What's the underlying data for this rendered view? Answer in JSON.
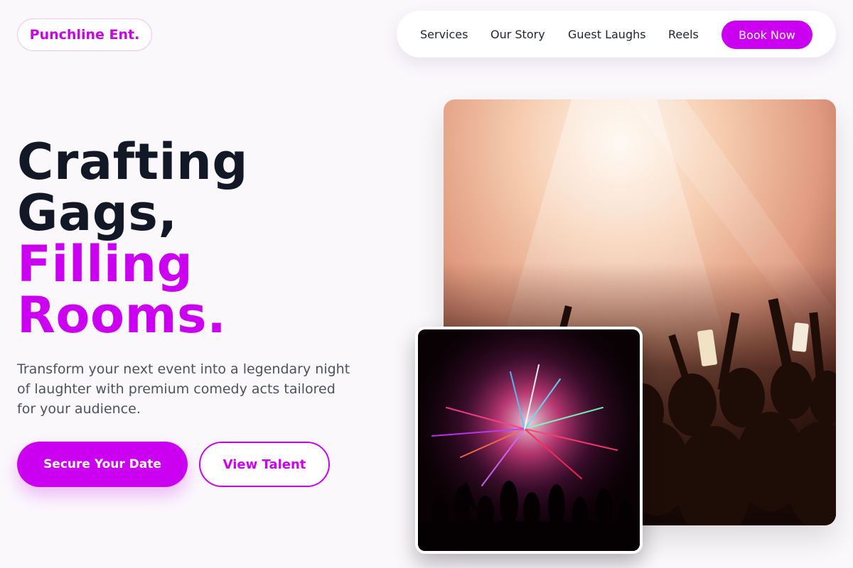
{
  "brand": {
    "name": "Punchline Ent."
  },
  "nav": {
    "links": [
      "Services",
      "Our Story",
      "Guest Laughs",
      "Reels"
    ],
    "cta": "Book Now"
  },
  "hero": {
    "line1": "Crafting",
    "line2": "Gags,",
    "line3": "Filling",
    "line4": "Rooms.",
    "subtitle": "Transform your next event into a legendary night of laughter with premium comedy acts tailored for your audience.",
    "primary_button": "Secure Your Date",
    "secondary_button": "View Talent",
    "concert_image_icon": "concert-crowd-photo",
    "fireworks_image_icon": "fireworks-crowd-photo"
  },
  "colors": {
    "accent": "#cc00f0",
    "heading": "#121826",
    "body_text": "#4b5260",
    "background": "#fbf8fc"
  }
}
